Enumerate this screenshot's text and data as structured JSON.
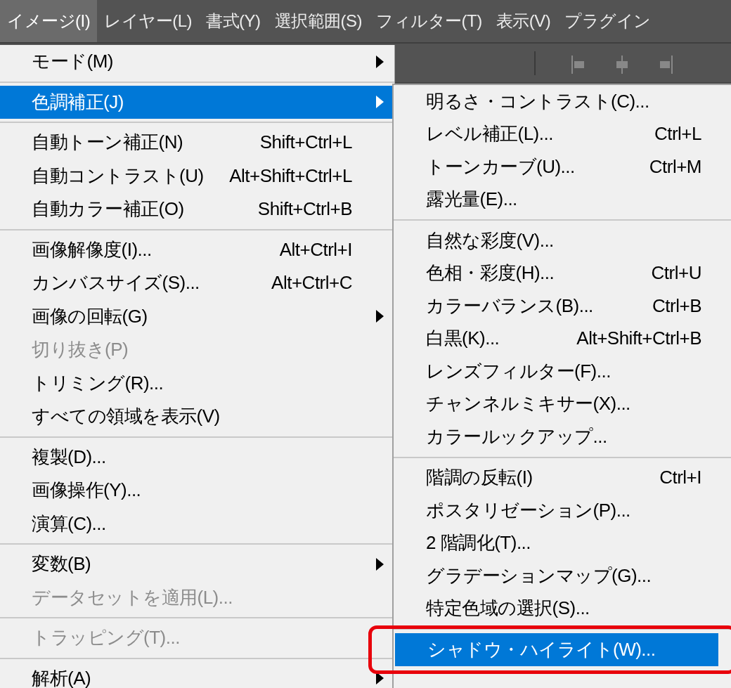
{
  "menubar": [
    {
      "label": "イメージ(I)",
      "selected": true
    },
    {
      "label": "レイヤー(L)",
      "selected": false
    },
    {
      "label": "書式(Y)",
      "selected": false
    },
    {
      "label": "選択範囲(S)",
      "selected": false
    },
    {
      "label": "フィルター(T)",
      "selected": false
    },
    {
      "label": "表示(V)",
      "selected": false
    },
    {
      "label": "プラグイン",
      "selected": false
    }
  ],
  "menu": {
    "items": [
      {
        "kind": "item",
        "label": "モード(M)",
        "submenu": true,
        "selected": false,
        "disabled": false
      },
      {
        "kind": "separator"
      },
      {
        "kind": "item",
        "label": "色調補正(J)",
        "submenu": true,
        "selected": true,
        "disabled": false
      },
      {
        "kind": "separator"
      },
      {
        "kind": "item",
        "label": "自動トーン補正(N)",
        "shortcut": "Shift+Ctrl+L",
        "selected": false,
        "disabled": false
      },
      {
        "kind": "item",
        "label": "自動コントラスト(U)",
        "shortcut": "Alt+Shift+Ctrl+L",
        "selected": false,
        "disabled": false
      },
      {
        "kind": "item",
        "label": "自動カラー補正(O)",
        "shortcut": "Shift+Ctrl+B",
        "selected": false,
        "disabled": false
      },
      {
        "kind": "separator"
      },
      {
        "kind": "item",
        "label": "画像解像度(I)...",
        "shortcut": "Alt+Ctrl+I",
        "selected": false,
        "disabled": false
      },
      {
        "kind": "item",
        "label": "カンバスサイズ(S)...",
        "shortcut": "Alt+Ctrl+C",
        "selected": false,
        "disabled": false
      },
      {
        "kind": "item",
        "label": "画像の回転(G)",
        "submenu": true,
        "selected": false,
        "disabled": false
      },
      {
        "kind": "item",
        "label": "切り抜き(P)",
        "selected": false,
        "disabled": true
      },
      {
        "kind": "item",
        "label": "トリミング(R)...",
        "selected": false,
        "disabled": false
      },
      {
        "kind": "item",
        "label": "すべての領域を表示(V)",
        "selected": false,
        "disabled": false
      },
      {
        "kind": "separator"
      },
      {
        "kind": "item",
        "label": "複製(D)...",
        "selected": false,
        "disabled": false
      },
      {
        "kind": "item",
        "label": "画像操作(Y)...",
        "selected": false,
        "disabled": false
      },
      {
        "kind": "item",
        "label": "演算(C)...",
        "selected": false,
        "disabled": false
      },
      {
        "kind": "separator"
      },
      {
        "kind": "item",
        "label": "変数(B)",
        "submenu": true,
        "selected": false,
        "disabled": false
      },
      {
        "kind": "item",
        "label": "データセットを適用(L)...",
        "selected": false,
        "disabled": true
      },
      {
        "kind": "separator"
      },
      {
        "kind": "item",
        "label": "トラッピング(T)...",
        "selected": false,
        "disabled": true
      },
      {
        "kind": "separator"
      },
      {
        "kind": "item",
        "label": "解析(A)",
        "submenu": true,
        "selected": false,
        "disabled": false
      }
    ]
  },
  "submenu": {
    "items": [
      {
        "kind": "item",
        "label": "明るさ・コントラスト(C)...",
        "selected": false,
        "outlined": false
      },
      {
        "kind": "item",
        "label": "レベル補正(L)...",
        "shortcut": "Ctrl+L",
        "selected": false,
        "outlined": false
      },
      {
        "kind": "item",
        "label": "トーンカーブ(U)...",
        "shortcut": "Ctrl+M",
        "selected": false,
        "outlined": false
      },
      {
        "kind": "item",
        "label": "露光量(E)...",
        "selected": false,
        "outlined": false
      },
      {
        "kind": "separator"
      },
      {
        "kind": "item",
        "label": "自然な彩度(V)...",
        "selected": false,
        "outlined": false
      },
      {
        "kind": "item",
        "label": "色相・彩度(H)...",
        "shortcut": "Ctrl+U",
        "selected": false,
        "outlined": false
      },
      {
        "kind": "item",
        "label": "カラーバランス(B)...",
        "shortcut": "Ctrl+B",
        "selected": false,
        "outlined": false
      },
      {
        "kind": "item",
        "label": "白黒(K)...",
        "shortcut": "Alt+Shift+Ctrl+B",
        "selected": false,
        "outlined": false
      },
      {
        "kind": "item",
        "label": "レンズフィルター(F)...",
        "selected": false,
        "outlined": false
      },
      {
        "kind": "item",
        "label": "チャンネルミキサー(X)...",
        "selected": false,
        "outlined": false
      },
      {
        "kind": "item",
        "label": "カラールックアップ...",
        "selected": false,
        "outlined": false
      },
      {
        "kind": "separator"
      },
      {
        "kind": "item",
        "label": "階調の反転(I)",
        "shortcut": "Ctrl+I",
        "selected": false,
        "outlined": false
      },
      {
        "kind": "item",
        "label": "ポスタリゼーション(P)...",
        "selected": false,
        "outlined": false
      },
      {
        "kind": "item",
        "label": "2 階調化(T)...",
        "selected": false,
        "outlined": false
      },
      {
        "kind": "item",
        "label": "グラデーションマップ(G)...",
        "selected": false,
        "outlined": false
      },
      {
        "kind": "item",
        "label": "特定色域の選択(S)...",
        "selected": false,
        "outlined": false
      },
      {
        "kind": "separator"
      },
      {
        "kind": "item",
        "label": "シャドウ・ハイライト(W)...",
        "selected": true,
        "outlined": true
      }
    ]
  }
}
